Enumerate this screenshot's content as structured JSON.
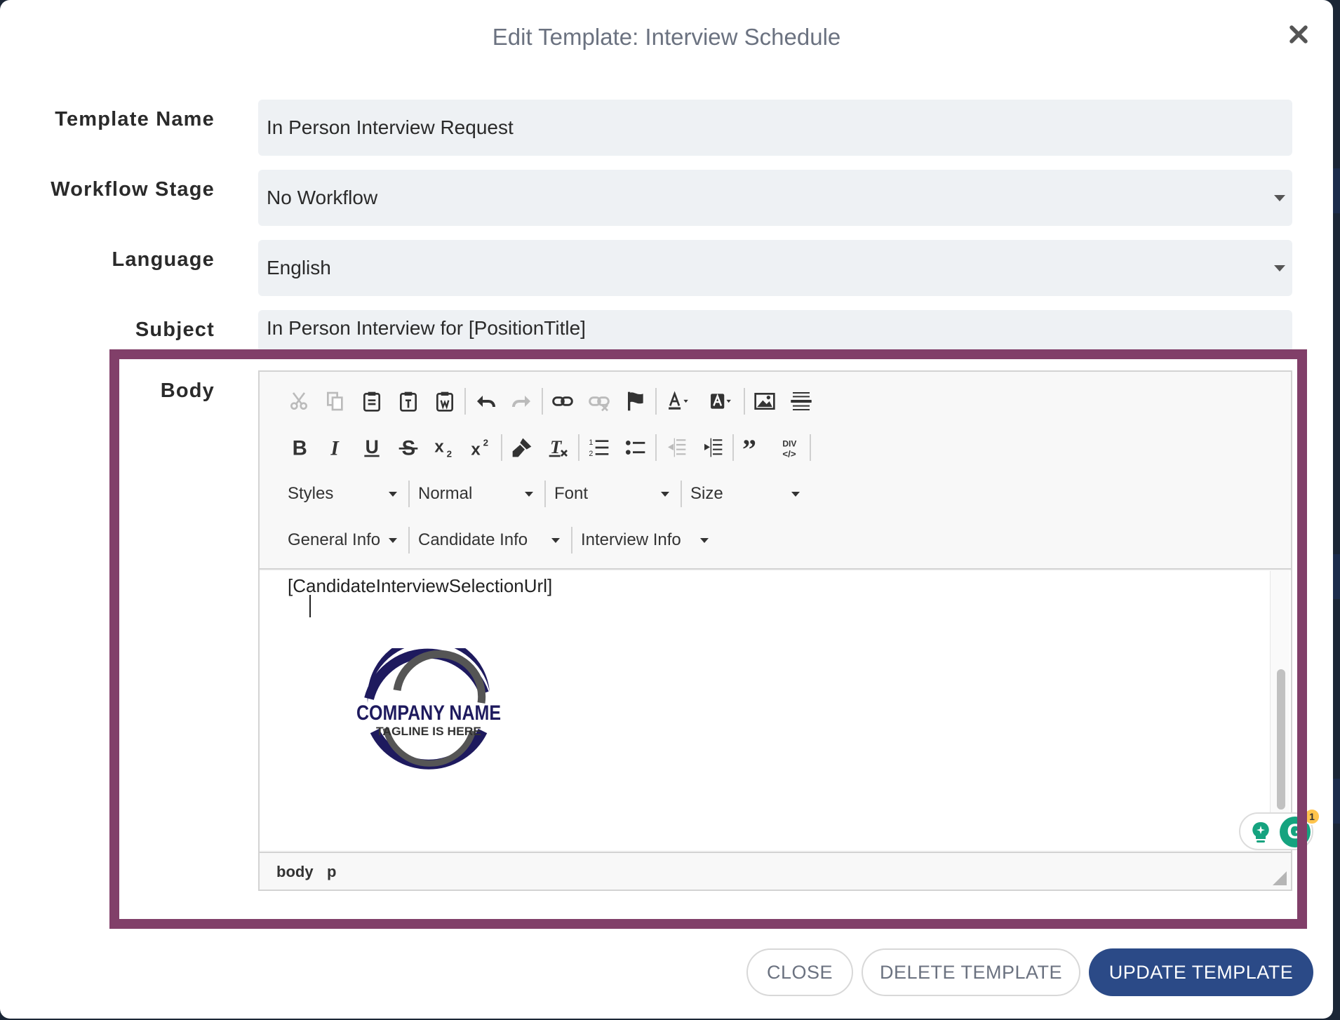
{
  "modal": {
    "title": "Edit Template: Interview Schedule",
    "close_icon": "close-x-icon"
  },
  "form": {
    "template_name": {
      "label": "Template Name",
      "value": "In Person Interview Request"
    },
    "workflow_stage": {
      "label": "Workflow Stage",
      "value": "No Workflow"
    },
    "language": {
      "label": "Language",
      "value": "English"
    },
    "subject": {
      "label": "Subject",
      "value": "In Person Interview for [PositionTitle]"
    },
    "body": {
      "label": "Body"
    }
  },
  "editor": {
    "dropdowns_row1": [
      "Styles",
      "Normal",
      "Font",
      "Size"
    ],
    "dropdowns_row2": [
      "General Info",
      "Candidate Info",
      "Interview Info"
    ],
    "content_text": "[CandidateInterviewSelectionUrl]",
    "logo": {
      "name": "COMPANY NAME",
      "tagline": "TAGLINE IS HERE"
    },
    "path": [
      "body",
      "p"
    ],
    "grammarly_badge": "1",
    "grammarly_letter": "G"
  },
  "buttons": {
    "close": "CLOSE",
    "delete": "DELETE TEMPLATE",
    "update": "UPDATE TEMPLATE"
  },
  "colors": {
    "highlight": "#813f69",
    "primary": "#2b4a87",
    "grammarly": "#15a37f"
  }
}
